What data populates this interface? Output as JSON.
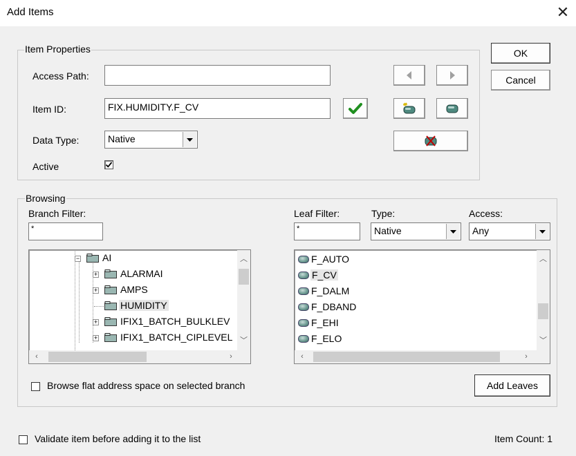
{
  "window": {
    "title": "Add Items",
    "close_glyph": "✕"
  },
  "item_properties": {
    "legend": "Item Properties",
    "access_path_label": "Access Path:",
    "access_path_value": "",
    "item_id_label": "Item ID:",
    "item_id_value": "FIX.HUMIDITY.F_CV",
    "data_type_label": "Data Type:",
    "data_type_value": "Native",
    "active_label": "Active",
    "active_checked": true
  },
  "buttons": {
    "ok": "OK",
    "cancel": "Cancel",
    "add_leaves": "Add Leaves"
  },
  "browsing": {
    "legend": "Browsing",
    "branch_filter_label": "Branch Filter:",
    "branch_filter_value": "*",
    "leaf_filter_label": "Leaf Filter:",
    "leaf_filter_value": "*",
    "type_label": "Type:",
    "type_value": "Native",
    "access_label": "Access:",
    "access_value": "Any",
    "tree_items": [
      {
        "label": "AI"
      },
      {
        "label": "ALARMAI"
      },
      {
        "label": "AMPS"
      },
      {
        "label": "HUMIDITY"
      },
      {
        "label": "IFIX1_BATCH_BULKLEV"
      },
      {
        "label": "IFIX1_BATCH_CIPLEVEL"
      }
    ],
    "leaf_items": [
      {
        "label": "F_AUTO"
      },
      {
        "label": "F_CV"
      },
      {
        "label": "F_DALM"
      },
      {
        "label": "F_DBAND"
      },
      {
        "label": "F_EHI"
      },
      {
        "label": "F_ELO"
      }
    ],
    "browse_flat_label": "Browse flat address space on selected branch",
    "browse_flat_checked": false
  },
  "footer": {
    "validate_label": "Validate item before adding it to the list",
    "validate_checked": false,
    "item_count": "Item Count: 1"
  },
  "colors": {
    "check_green": "#1f8f1f",
    "selection": "#e6e6e6"
  }
}
